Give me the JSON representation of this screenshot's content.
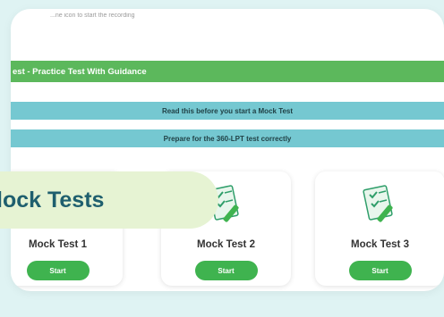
{
  "top_note": "...ne icon to start the recording",
  "banner_main": "est - Practice Test With Guidance",
  "info_banners": [
    "Read this before you start a Mock Test",
    "Prepare for the 360-LPT test correctly"
  ],
  "tests": [
    {
      "title": "Mock Test 1",
      "button": "Start"
    },
    {
      "title": "Mock Test 2",
      "button": "Start"
    },
    {
      "title": "Mock Test 3",
      "button": "Start"
    }
  ],
  "overlay_title": "lock Tests",
  "colors": {
    "green_banner": "#5cb85c",
    "info_banner": "#75c8d1",
    "start_button": "#3fb34f",
    "overlay_bg": "#e6f3d3",
    "overlay_text": "#1f5f6e"
  }
}
